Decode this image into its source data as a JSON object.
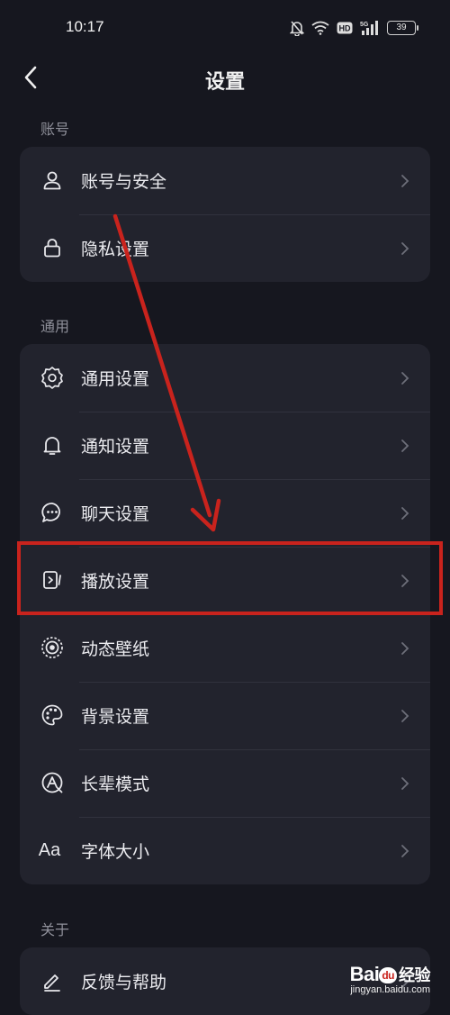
{
  "status_bar": {
    "time": "10:17",
    "battery": "39",
    "network": "5G",
    "hd": "HD"
  },
  "header": {
    "title": "设置"
  },
  "sections": {
    "account": {
      "label": "账号",
      "items": [
        {
          "label": "账号与安全",
          "icon": "user-icon"
        },
        {
          "label": "隐私设置",
          "icon": "lock-icon"
        }
      ]
    },
    "general": {
      "label": "通用",
      "items": [
        {
          "label": "通用设置",
          "icon": "gear-icon"
        },
        {
          "label": "通知设置",
          "icon": "bell-icon"
        },
        {
          "label": "聊天设置",
          "icon": "chat-bubble-icon"
        },
        {
          "label": "播放设置",
          "icon": "play-screen-icon"
        },
        {
          "label": "动态壁纸",
          "icon": "wallpaper-icon"
        },
        {
          "label": "背景设置",
          "icon": "palette-icon"
        },
        {
          "label": "长辈模式",
          "icon": "elder-mode-icon"
        },
        {
          "label": "字体大小",
          "icon": "font-size-icon",
          "glyph": "Aa"
        }
      ]
    },
    "about": {
      "label": "关于",
      "items": [
        {
          "label": "反馈与帮助",
          "icon": "pencil-icon"
        }
      ]
    }
  },
  "annotation": {
    "color": "#c9231d",
    "highlighted_item": "播放设置"
  },
  "watermark": {
    "brand_latin": "Bai",
    "brand_paw": "du",
    "brand_cn": "经验",
    "url": "jingyan.baidu.com"
  }
}
